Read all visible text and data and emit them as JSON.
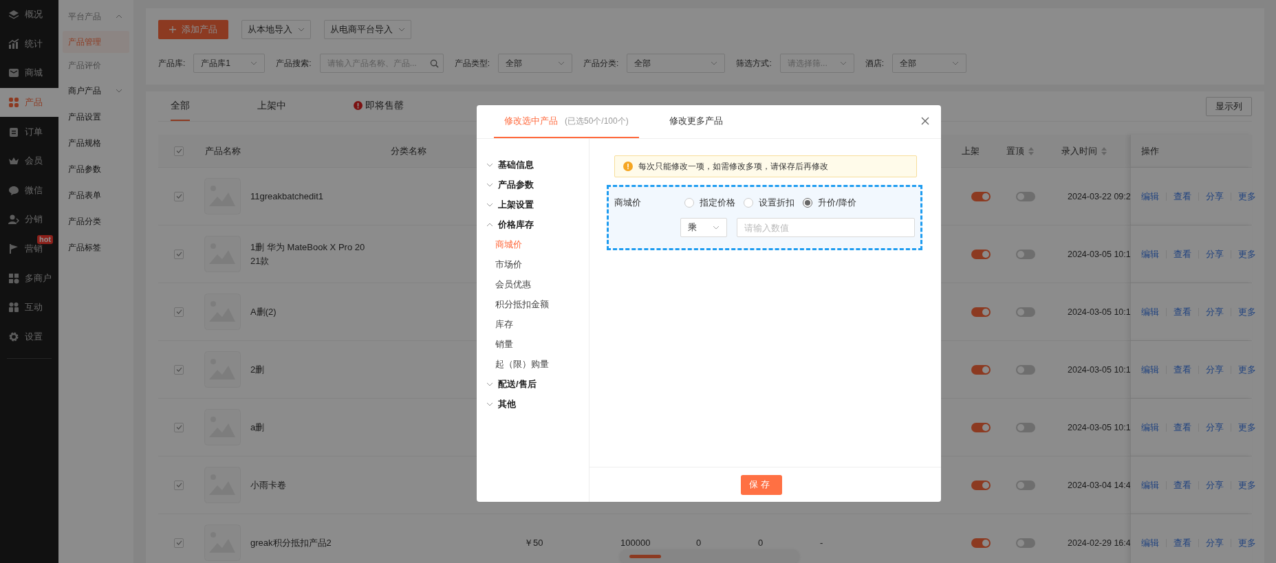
{
  "sidebar": {
    "items": [
      {
        "label": "概况",
        "selected": false
      },
      {
        "label": "统计",
        "selected": false
      },
      {
        "label": "商城",
        "selected": false
      },
      {
        "label": "产品",
        "selected": true
      },
      {
        "label": "订单",
        "selected": false
      },
      {
        "label": "会员",
        "selected": false
      },
      {
        "label": "微信",
        "selected": false
      },
      {
        "label": "分销",
        "selected": false
      },
      {
        "label": "营销",
        "selected": false,
        "badge": "hot"
      },
      {
        "label": "多商户",
        "selected": false
      },
      {
        "label": "互动",
        "selected": false
      },
      {
        "label": "设置",
        "selected": false
      }
    ]
  },
  "subnav": {
    "items": [
      {
        "kind": "group",
        "label": "平台产品",
        "expanded": true,
        "children": [
          {
            "label": "产品管理",
            "selected": true
          },
          {
            "label": "产品评价",
            "selected": false
          }
        ]
      },
      {
        "kind": "group",
        "label": "商户产品",
        "expanded": false
      },
      {
        "kind": "link",
        "label": "产品设置",
        "selected": false
      },
      {
        "kind": "link",
        "label": "产品规格",
        "selected": false
      },
      {
        "kind": "link",
        "label": "产品参数",
        "selected": false
      },
      {
        "kind": "link",
        "label": "产品表单",
        "selected": false
      },
      {
        "kind": "link",
        "label": "产品分类",
        "selected": false
      },
      {
        "kind": "link",
        "label": "产品标签",
        "selected": false
      }
    ]
  },
  "toolbar": {
    "add_button": "添加产品",
    "dropdowns": [
      "从本地导入",
      "从电商平台导入"
    ]
  },
  "filters": [
    {
      "label": "产品库:",
      "kind": "select",
      "value": "产品库1"
    },
    {
      "label": "产品搜索:",
      "kind": "search",
      "placeholder": "请输入产品名称、产品..."
    },
    {
      "label": "产品类型:",
      "kind": "select",
      "value": "全部"
    },
    {
      "label": "产品分类:",
      "kind": "select",
      "value": "全部"
    },
    {
      "label": "筛选方式:",
      "kind": "select",
      "placeholder": "请选择筛..."
    },
    {
      "label": "酒店:",
      "kind": "select",
      "value": "全部"
    }
  ],
  "tabs": [
    {
      "label": "全部",
      "selected": true,
      "alert": false
    },
    {
      "label": "上架中",
      "selected": false,
      "alert": false
    },
    {
      "label": "即将售罄",
      "selected": false,
      "alert": true
    }
  ],
  "columns_button": "显示列",
  "table": {
    "header_checked": true,
    "columns": [
      {
        "kind": "name",
        "label": "产品名称"
      },
      {
        "kind": "category",
        "label": "分类名称"
      },
      {
        "kind": "listed",
        "label": "上架"
      },
      {
        "kind": "pinned",
        "label": "置顶",
        "sortable": true
      },
      {
        "kind": "created",
        "label": "录入时间",
        "sortable": true
      },
      {
        "kind": "actions",
        "label": "操作"
      }
    ],
    "rows": [
      {
        "checked": true,
        "name": "11greakbatchedit1",
        "listed": true,
        "pinned": false,
        "created": "2024-03-22 09:2",
        "actions": [
          "编辑",
          "查看",
          "分享",
          "更多"
        ]
      },
      {
        "checked": true,
        "name": "1删 华为 MateBook X Pro 2021款",
        "listed": true,
        "pinned": false,
        "created": "2024-03-05 10:1",
        "actions": [
          "编辑",
          "查看",
          "分享",
          "更多"
        ]
      },
      {
        "checked": true,
        "name": "A删(2)",
        "listed": true,
        "pinned": false,
        "created": "2024-03-05 10:1",
        "actions": [
          "编辑",
          "查看",
          "分享",
          "更多"
        ]
      },
      {
        "checked": true,
        "name": "2删",
        "listed": true,
        "pinned": false,
        "created": "2024-03-05 10:1",
        "actions": [
          "编辑",
          "查看",
          "分享",
          "更多"
        ]
      },
      {
        "checked": true,
        "name": "a删",
        "listed": true,
        "pinned": false,
        "created": "2024-03-05 10:1",
        "actions": [
          "编辑",
          "查看",
          "分享",
          "更多"
        ]
      },
      {
        "checked": true,
        "name": "小雨卡卷",
        "listed": true,
        "pinned": false,
        "created": "2024-03-04 14:4",
        "actions": [
          "编辑",
          "查看",
          "分享",
          "更多"
        ]
      },
      {
        "checked": true,
        "name": "greak积分抵扣产品2",
        "listed": true,
        "pinned": false,
        "created": "2024-02-29 16:4",
        "cells": [
          "￥50",
          "100000",
          "0",
          "0",
          "-"
        ],
        "actions": [
          "编辑",
          "查看",
          "分享",
          "更多"
        ]
      }
    ]
  },
  "modal": {
    "tabs": [
      {
        "label": "修改选中产品",
        "note": "(已选50个/100个)",
        "selected": true
      },
      {
        "label": "修改更多产品",
        "selected": false
      }
    ],
    "nav": [
      {
        "label": "基础信息",
        "expanded": false
      },
      {
        "label": "产品参数",
        "expanded": false
      },
      {
        "label": "上架设置",
        "expanded": false
      },
      {
        "label": "价格库存",
        "expanded": true,
        "children": [
          {
            "label": "商城价",
            "selected": true
          },
          {
            "label": "市场价",
            "selected": false
          },
          {
            "label": "会员优惠",
            "selected": false
          },
          {
            "label": "积分抵扣金额",
            "selected": false
          },
          {
            "label": "库存",
            "selected": false
          },
          {
            "label": "销量",
            "selected": false
          },
          {
            "label": "起（限）购量",
            "selected": false
          }
        ]
      },
      {
        "label": "配送/售后",
        "expanded": false
      },
      {
        "label": "其他",
        "expanded": false
      }
    ],
    "notice": "每次只能修改一项，如需修改多项，请保存后再修改",
    "field": {
      "label": "商城价",
      "options": [
        {
          "label": "指定价格",
          "selected": false
        },
        {
          "label": "设置折扣",
          "selected": false
        },
        {
          "label": "升价/降价",
          "selected": true
        }
      ],
      "operator": "乘",
      "placeholder": "请输入数值"
    },
    "save_button": "保存"
  }
}
